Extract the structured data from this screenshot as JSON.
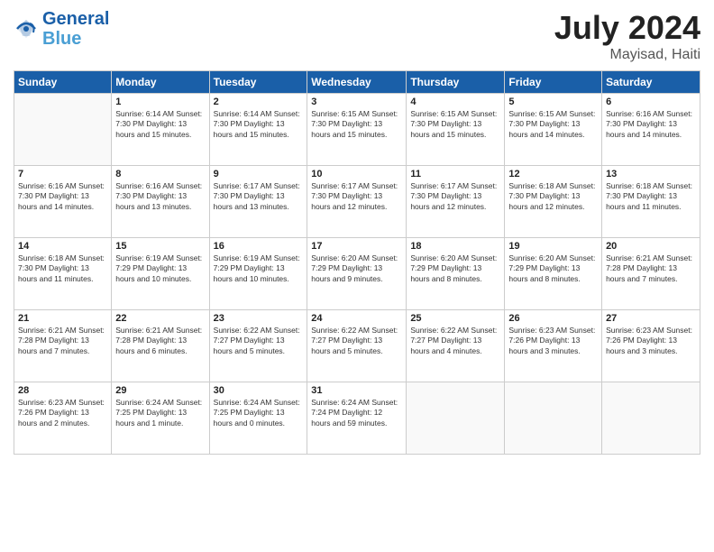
{
  "header": {
    "logo_line1": "General",
    "logo_line2": "Blue",
    "month_year": "July 2024",
    "location": "Mayisad, Haiti"
  },
  "weekdays": [
    "Sunday",
    "Monday",
    "Tuesday",
    "Wednesday",
    "Thursday",
    "Friday",
    "Saturday"
  ],
  "weeks": [
    [
      {
        "num": "",
        "info": ""
      },
      {
        "num": "1",
        "info": "Sunrise: 6:14 AM\nSunset: 7:30 PM\nDaylight: 13 hours\nand 15 minutes."
      },
      {
        "num": "2",
        "info": "Sunrise: 6:14 AM\nSunset: 7:30 PM\nDaylight: 13 hours\nand 15 minutes."
      },
      {
        "num": "3",
        "info": "Sunrise: 6:15 AM\nSunset: 7:30 PM\nDaylight: 13 hours\nand 15 minutes."
      },
      {
        "num": "4",
        "info": "Sunrise: 6:15 AM\nSunset: 7:30 PM\nDaylight: 13 hours\nand 15 minutes."
      },
      {
        "num": "5",
        "info": "Sunrise: 6:15 AM\nSunset: 7:30 PM\nDaylight: 13 hours\nand 14 minutes."
      },
      {
        "num": "6",
        "info": "Sunrise: 6:16 AM\nSunset: 7:30 PM\nDaylight: 13 hours\nand 14 minutes."
      }
    ],
    [
      {
        "num": "7",
        "info": "Sunrise: 6:16 AM\nSunset: 7:30 PM\nDaylight: 13 hours\nand 14 minutes."
      },
      {
        "num": "8",
        "info": "Sunrise: 6:16 AM\nSunset: 7:30 PM\nDaylight: 13 hours\nand 13 minutes."
      },
      {
        "num": "9",
        "info": "Sunrise: 6:17 AM\nSunset: 7:30 PM\nDaylight: 13 hours\nand 13 minutes."
      },
      {
        "num": "10",
        "info": "Sunrise: 6:17 AM\nSunset: 7:30 PM\nDaylight: 13 hours\nand 12 minutes."
      },
      {
        "num": "11",
        "info": "Sunrise: 6:17 AM\nSunset: 7:30 PM\nDaylight: 13 hours\nand 12 minutes."
      },
      {
        "num": "12",
        "info": "Sunrise: 6:18 AM\nSunset: 7:30 PM\nDaylight: 13 hours\nand 12 minutes."
      },
      {
        "num": "13",
        "info": "Sunrise: 6:18 AM\nSunset: 7:30 PM\nDaylight: 13 hours\nand 11 minutes."
      }
    ],
    [
      {
        "num": "14",
        "info": "Sunrise: 6:18 AM\nSunset: 7:30 PM\nDaylight: 13 hours\nand 11 minutes."
      },
      {
        "num": "15",
        "info": "Sunrise: 6:19 AM\nSunset: 7:29 PM\nDaylight: 13 hours\nand 10 minutes."
      },
      {
        "num": "16",
        "info": "Sunrise: 6:19 AM\nSunset: 7:29 PM\nDaylight: 13 hours\nand 10 minutes."
      },
      {
        "num": "17",
        "info": "Sunrise: 6:20 AM\nSunset: 7:29 PM\nDaylight: 13 hours\nand 9 minutes."
      },
      {
        "num": "18",
        "info": "Sunrise: 6:20 AM\nSunset: 7:29 PM\nDaylight: 13 hours\nand 8 minutes."
      },
      {
        "num": "19",
        "info": "Sunrise: 6:20 AM\nSunset: 7:29 PM\nDaylight: 13 hours\nand 8 minutes."
      },
      {
        "num": "20",
        "info": "Sunrise: 6:21 AM\nSunset: 7:28 PM\nDaylight: 13 hours\nand 7 minutes."
      }
    ],
    [
      {
        "num": "21",
        "info": "Sunrise: 6:21 AM\nSunset: 7:28 PM\nDaylight: 13 hours\nand 7 minutes."
      },
      {
        "num": "22",
        "info": "Sunrise: 6:21 AM\nSunset: 7:28 PM\nDaylight: 13 hours\nand 6 minutes."
      },
      {
        "num": "23",
        "info": "Sunrise: 6:22 AM\nSunset: 7:27 PM\nDaylight: 13 hours\nand 5 minutes."
      },
      {
        "num": "24",
        "info": "Sunrise: 6:22 AM\nSunset: 7:27 PM\nDaylight: 13 hours\nand 5 minutes."
      },
      {
        "num": "25",
        "info": "Sunrise: 6:22 AM\nSunset: 7:27 PM\nDaylight: 13 hours\nand 4 minutes."
      },
      {
        "num": "26",
        "info": "Sunrise: 6:23 AM\nSunset: 7:26 PM\nDaylight: 13 hours\nand 3 minutes."
      },
      {
        "num": "27",
        "info": "Sunrise: 6:23 AM\nSunset: 7:26 PM\nDaylight: 13 hours\nand 3 minutes."
      }
    ],
    [
      {
        "num": "28",
        "info": "Sunrise: 6:23 AM\nSunset: 7:26 PM\nDaylight: 13 hours\nand 2 minutes."
      },
      {
        "num": "29",
        "info": "Sunrise: 6:24 AM\nSunset: 7:25 PM\nDaylight: 13 hours\nand 1 minute."
      },
      {
        "num": "30",
        "info": "Sunrise: 6:24 AM\nSunset: 7:25 PM\nDaylight: 13 hours\nand 0 minutes."
      },
      {
        "num": "31",
        "info": "Sunrise: 6:24 AM\nSunset: 7:24 PM\nDaylight: 12 hours\nand 59 minutes."
      },
      {
        "num": "",
        "info": ""
      },
      {
        "num": "",
        "info": ""
      },
      {
        "num": "",
        "info": ""
      }
    ]
  ]
}
